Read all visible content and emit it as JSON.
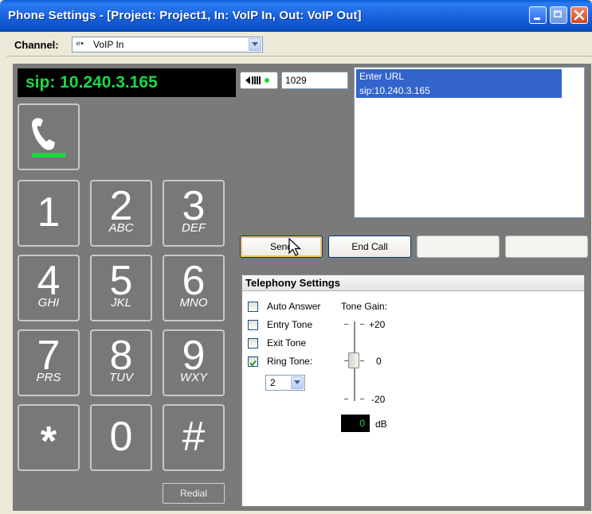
{
  "window": {
    "title": "Phone Settings - [Project: Project1, In: VoIP In, Out: VoIP Out]"
  },
  "channel": {
    "label": "Channel:",
    "value": "VoIP In",
    "icon": "voip-icon"
  },
  "phone": {
    "display": "sip: 10.240.3.165",
    "extension": "1029",
    "redial_label": "Redial",
    "keys": [
      {
        "digit": "1",
        "letters": ""
      },
      {
        "digit": "2",
        "letters": "ABC"
      },
      {
        "digit": "3",
        "letters": "DEF"
      },
      {
        "digit": "4",
        "letters": "GHI"
      },
      {
        "digit": "5",
        "letters": "JKL"
      },
      {
        "digit": "6",
        "letters": "MNO"
      },
      {
        "digit": "7",
        "letters": "PRS"
      },
      {
        "digit": "8",
        "letters": "TUV"
      },
      {
        "digit": "9",
        "letters": "WXY"
      },
      {
        "digit": "*",
        "letters": ""
      },
      {
        "digit": "0",
        "letters": ""
      },
      {
        "digit": "#",
        "letters": ""
      }
    ]
  },
  "url_list": {
    "items": [
      "Enter URL",
      "sip:10.240.3.165"
    ]
  },
  "buttons": {
    "send": "Send",
    "end_call": "End Call"
  },
  "telephony": {
    "title": "Telephony Settings",
    "auto_answer": {
      "label": "Auto Answer",
      "checked": false
    },
    "entry_tone": {
      "label": "Entry Tone",
      "checked": false
    },
    "exit_tone": {
      "label": "Exit Tone",
      "checked": false
    },
    "ring_tone": {
      "label": "Ring Tone:",
      "checked": true,
      "value": "2"
    },
    "tone_gain": {
      "label": "Tone Gain:",
      "max": "+20",
      "mid": "0",
      "min": "-20",
      "value": "0",
      "unit": "dB"
    }
  },
  "colors": {
    "display_text": "#1bd84a",
    "panel_bg": "#7a7a7a",
    "title_bar": "#0b52c8",
    "selection": "#3264cc"
  }
}
